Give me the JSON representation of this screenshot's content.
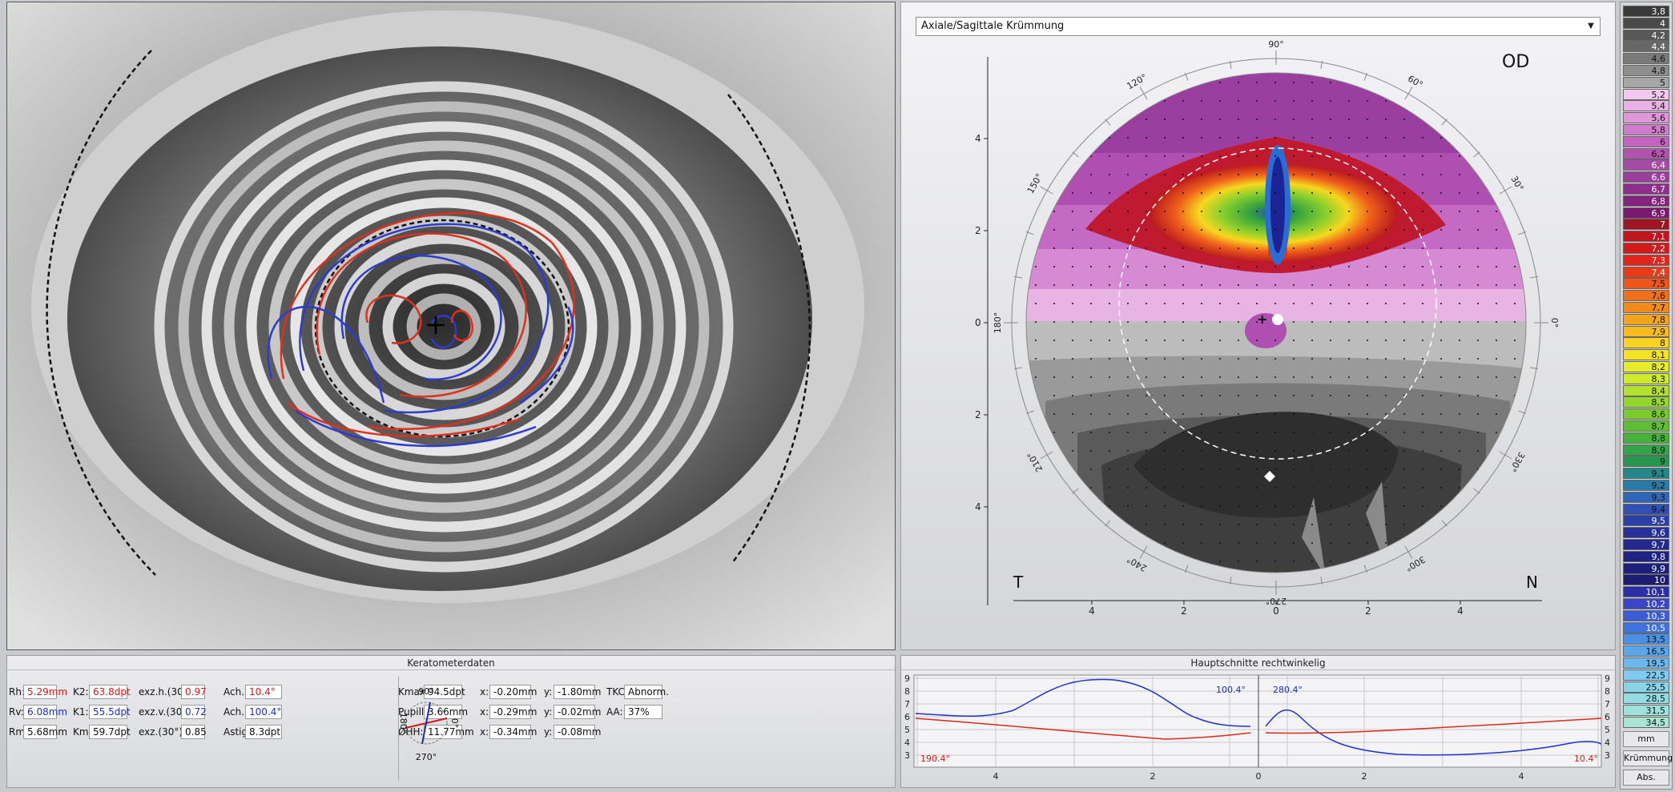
{
  "eye_view": {},
  "map": {
    "dropdown_value": "Axiale/Sagittale Krümmung",
    "eye_label": "OD",
    "left_label": "T",
    "right_label": "N",
    "angle_labels": [
      "90°",
      "60°",
      "30°",
      "0°",
      "330°",
      "300°",
      "270°",
      "240°",
      "210°",
      "180°",
      "150°",
      "120°"
    ],
    "y_ticks": [
      "4",
      "2",
      "0",
      "2",
      "4"
    ],
    "x_ticks": [
      "4",
      "2",
      "0",
      "2",
      "4"
    ]
  },
  "scale": {
    "values": [
      "3,8",
      "4",
      "4,2",
      "4,4",
      "4,6",
      "4,8",
      "5",
      "5,2",
      "5,4",
      "5,6",
      "5,8",
      "6",
      "6,2",
      "6,4",
      "6,6",
      "6,7",
      "6,8",
      "6,9",
      "7",
      "7,1",
      "7,2",
      "7,3",
      "7,4",
      "7,5",
      "7,6",
      "7,7",
      "7,8",
      "7,9",
      "8",
      "8,1",
      "8,2",
      "8,3",
      "8,4",
      "8,5",
      "8,6",
      "8,7",
      "8,8",
      "8,9",
      "9",
      "9,1",
      "9,2",
      "9,3",
      "9,4",
      "9,5",
      "9,6",
      "9,7",
      "9,8",
      "9,9",
      "10",
      "10,1",
      "10,2",
      "10,3",
      "10,5",
      "13,5",
      "16,5",
      "19,5",
      "22,5",
      "25,5",
      "28,5",
      "31,5",
      "34,5"
    ],
    "colors": [
      "#3a3a3a",
      "#4a4a4a",
      "#575757",
      "#676767",
      "#7a7a7a",
      "#8e8e8e",
      "#a6a6a6",
      "#f3c8ef",
      "#eab1e6",
      "#df96db",
      "#d07bcc",
      "#c264be",
      "#b452b0",
      "#a64aa6",
      "#9b3f9c",
      "#8f2e8c",
      "#85237d",
      "#7a1870",
      "#a01522",
      "#c2161e",
      "#d4191a",
      "#e2241a",
      "#ea3a18",
      "#f05418",
      "#f36e18",
      "#f48a1a",
      "#f6a31c",
      "#f7bb1e",
      "#f8d322",
      "#f4e324",
      "#e7ec28",
      "#cfe92b",
      "#b2e22c",
      "#94d72c",
      "#78cc2c",
      "#5ec030",
      "#46b23a",
      "#34a448",
      "#27964f",
      "#22888a",
      "#2a7aa8",
      "#3066b8",
      "#3050b4",
      "#2c3ea8",
      "#28309a",
      "#222890",
      "#1f2284",
      "#1d1f7c",
      "#1b1c74",
      "#2a2ea8",
      "#3a46c8",
      "#3c5cd6",
      "#3e72de",
      "#4a90e6",
      "#5aa6ea",
      "#6ab8ec",
      "#7ecaf0",
      "#8ad4ea",
      "#94dce4",
      "#9ee2dc",
      "#a8e6d4"
    ],
    "btn_unit": "mm",
    "btn_mode": "Krümmung",
    "btn_abs": "Abs."
  },
  "keratometer": {
    "title": "Keratometerdaten",
    "rows": [
      {
        "l1": "Rh:",
        "v1": "5.29mm",
        "l2": "K2:",
        "v2": "63.8dpt",
        "l3": "exz.h.(30°):",
        "v3": "0.97",
        "l4": "Ach. h:",
        "v4": "10.4°"
      },
      {
        "l1": "Rv:",
        "v1": "6.08mm",
        "l2": "K1:",
        "v2": "55.5dpt",
        "l3": "exz.v.(30°):",
        "v3": "0.72",
        "l4": "Ach. v:",
        "v4": "100.4°"
      },
      {
        "l1": "Rm:",
        "v1": "5.68mm",
        "l2": "Km:",
        "v2": "59.7dpt",
        "l3": "exz.(30°):",
        "v3": "0.85",
        "l4": "Astig.:",
        "v4": "8.3dpt"
      }
    ],
    "axis_top": "90°",
    "axis_bottom": "270°",
    "axis_left": "180°",
    "axis_right": "0°",
    "rows2": [
      {
        "l1": "Kmax:",
        "v1": "94.5dpt",
        "l2": "x:",
        "v2": "-0.20mm",
        "l3": "y:",
        "v3": "-1.80mm",
        "l4": "TKC:",
        "v4": "Abnorm."
      },
      {
        "l1": "Pupille:",
        "v1": "3.66mm",
        "l2": "x:",
        "v2": "-0.29mm",
        "l3": "y:",
        "v3": "-0.02mm",
        "l4": "AA:",
        "v4": "37%"
      },
      {
        "l1": "ØHH:",
        "v1": "11.77mm",
        "l2": "x:",
        "v2": "-0.34mm",
        "l3": "y:",
        "v3": "-0.08mm",
        "l4": "",
        "v4": ""
      }
    ]
  },
  "hauptschnitte": {
    "title": "Hauptschnitte rechtwinkelig",
    "label_blue_left": "100.4°",
    "label_blue_right": "280.4°",
    "label_red_left": "190.4°",
    "label_red_right": "10.4°",
    "y_ticks": [
      "9",
      "8",
      "7",
      "6",
      "5",
      "4",
      "3"
    ],
    "x_ticks": [
      "4",
      "2",
      "0",
      "2",
      "4"
    ]
  }
}
